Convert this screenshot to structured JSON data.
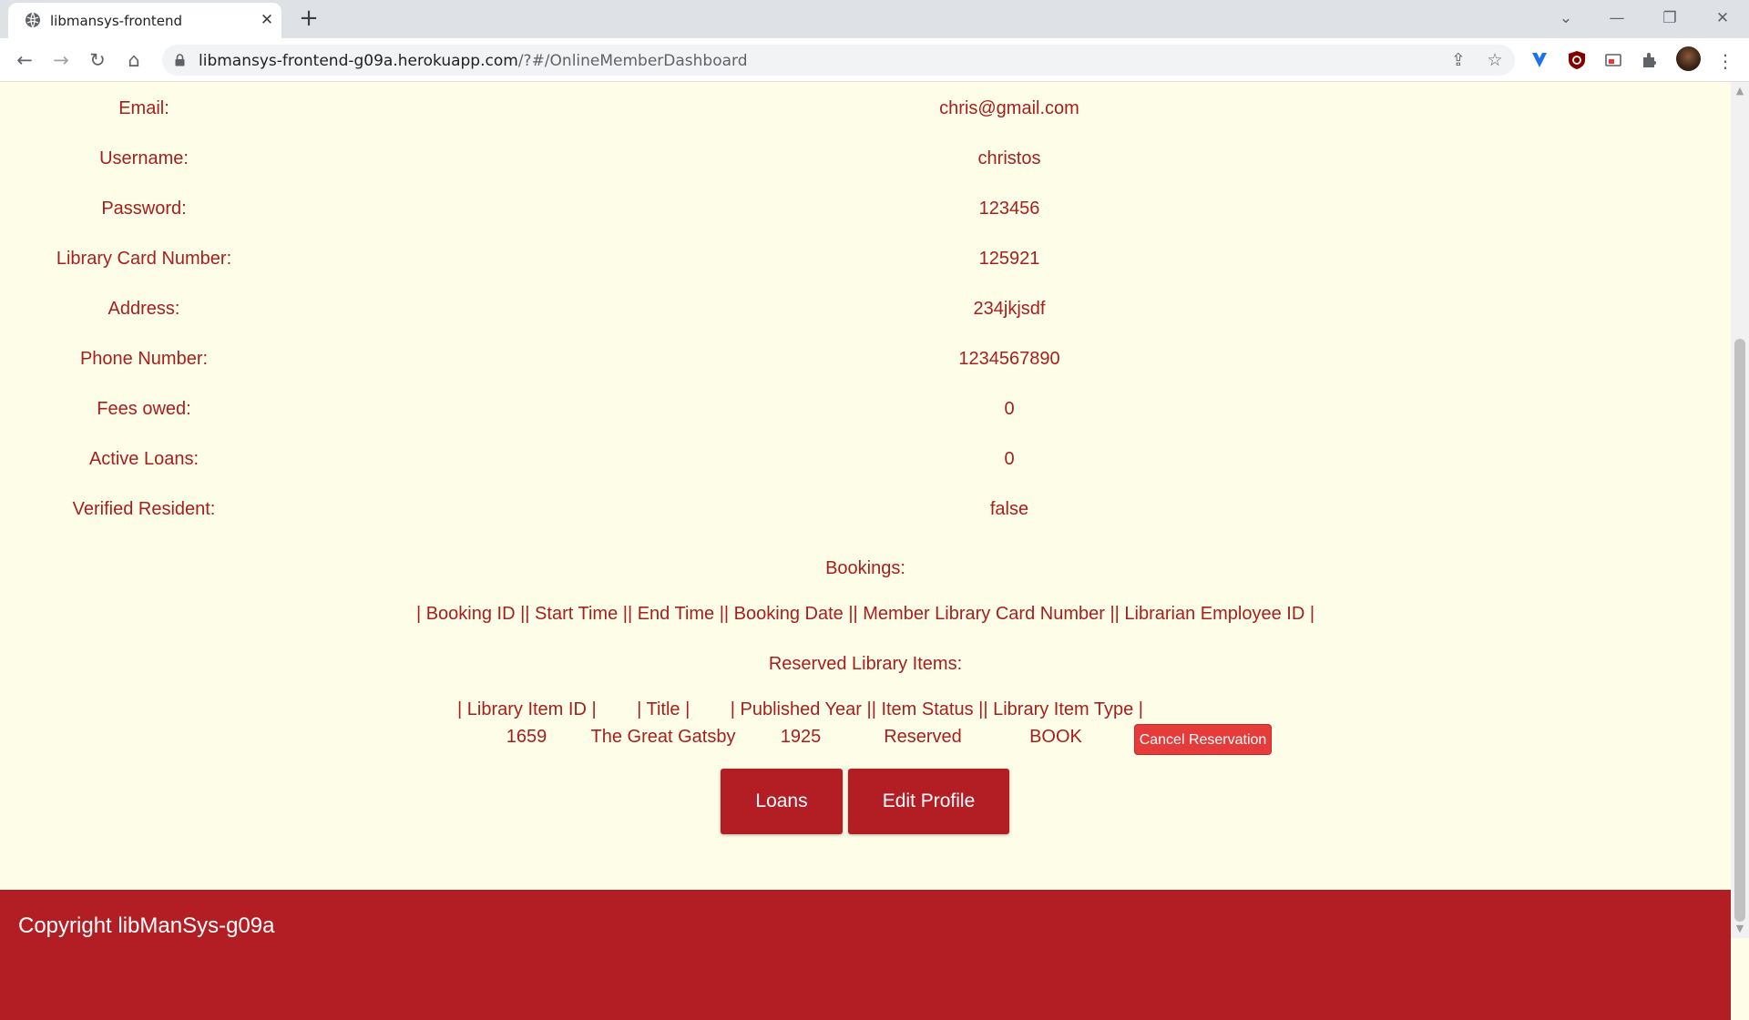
{
  "browser": {
    "tab_title": "libmansys-frontend",
    "tab_close": "✕",
    "new_tab": "+",
    "url_main": "libmansys-frontend-g09a.herokuapp.com",
    "url_rest": "/?#/OnlineMemberDashboard",
    "window_controls": {
      "dropdown": "⌄",
      "minimize": "—",
      "restore": "❐",
      "close": "✕"
    },
    "nav": {
      "back": "←",
      "forward": "→",
      "reload": "↻",
      "home": "⌂"
    },
    "omnibox_icons": {
      "share": "⇪",
      "bookmark": "☆"
    }
  },
  "profile": {
    "rows": [
      {
        "label": "Email:",
        "value": "chris@gmail.com"
      },
      {
        "label": "Username:",
        "value": "christos"
      },
      {
        "label": "Password:",
        "value": "123456"
      },
      {
        "label": "Library Card Number:",
        "value": "125921"
      },
      {
        "label": "Address:",
        "value": "234jkjsdf"
      },
      {
        "label": "Phone Number:",
        "value": "1234567890"
      },
      {
        "label": "Fees owed:",
        "value": "0"
      },
      {
        "label": "Active Loans:",
        "value": "0"
      },
      {
        "label": "Verified Resident:",
        "value": "false"
      }
    ]
  },
  "bookings": {
    "title": "Bookings:",
    "header": "| Booking ID || Start Time || End Time || Booking Date || Member Library Card Number || Librarian Employee ID |"
  },
  "reservations": {
    "title": "Reserved Library Items:",
    "header": "| Library Item ID |        | Title |        | Published Year || Item Status || Library Item Type |",
    "items": [
      {
        "id": "1659",
        "title": "The Great Gatsby",
        "year": "1925",
        "status": "Reserved",
        "type": "BOOK",
        "action": "Cancel Reservation"
      }
    ]
  },
  "actions": {
    "loans": "Loans",
    "edit_profile": "Edit Profile"
  },
  "footer": {
    "text": "Copyright libManSys-g09a"
  },
  "colors": {
    "text": "#a61f1f",
    "accent": "#b21e24",
    "cancel": "#e53b3b",
    "background": "#fefde7"
  }
}
